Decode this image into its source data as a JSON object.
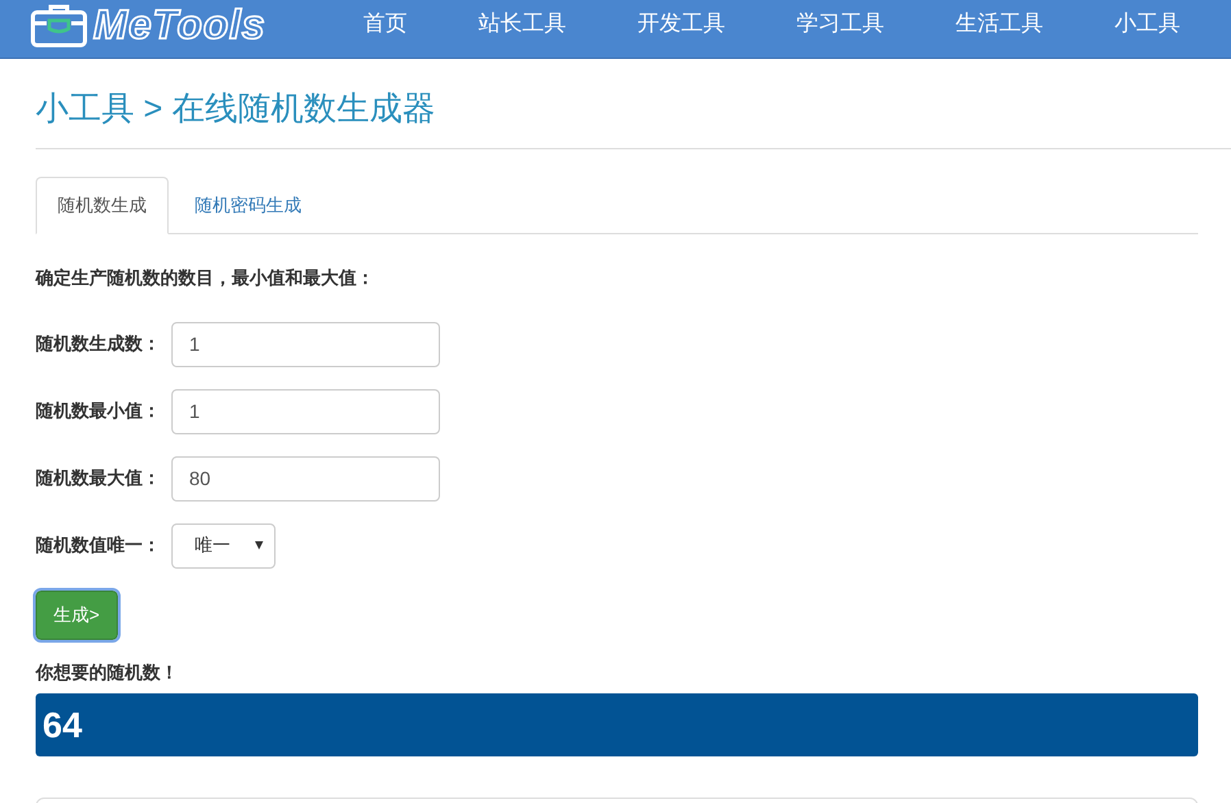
{
  "header": {
    "logo": "MeTools",
    "nav": [
      {
        "label": "首页"
      },
      {
        "label": "站长工具"
      },
      {
        "label": "开发工具"
      },
      {
        "label": "学习工具"
      },
      {
        "label": "生活工具"
      },
      {
        "label": "小工具"
      }
    ]
  },
  "page_title": "小工具 > 在线随机数生成器",
  "tabs": [
    {
      "label": "随机数生成",
      "selected": true
    },
    {
      "label": "随机密码生成",
      "selected": false
    }
  ],
  "intro": "确定生产随机数的数目，最小值和最大值：",
  "fields": [
    {
      "label": "随机数生成数：",
      "value": "1",
      "kind": "input"
    },
    {
      "label": "随机数最小值：",
      "value": "1",
      "kind": "input"
    },
    {
      "label": "随机数最大值：",
      "value": "80",
      "kind": "input"
    },
    {
      "label": "随机数值唯一：",
      "value": "唯一",
      "kind": "select"
    }
  ],
  "generate_button": "生成>",
  "result_label": "你想要的随机数！",
  "result": "64"
}
